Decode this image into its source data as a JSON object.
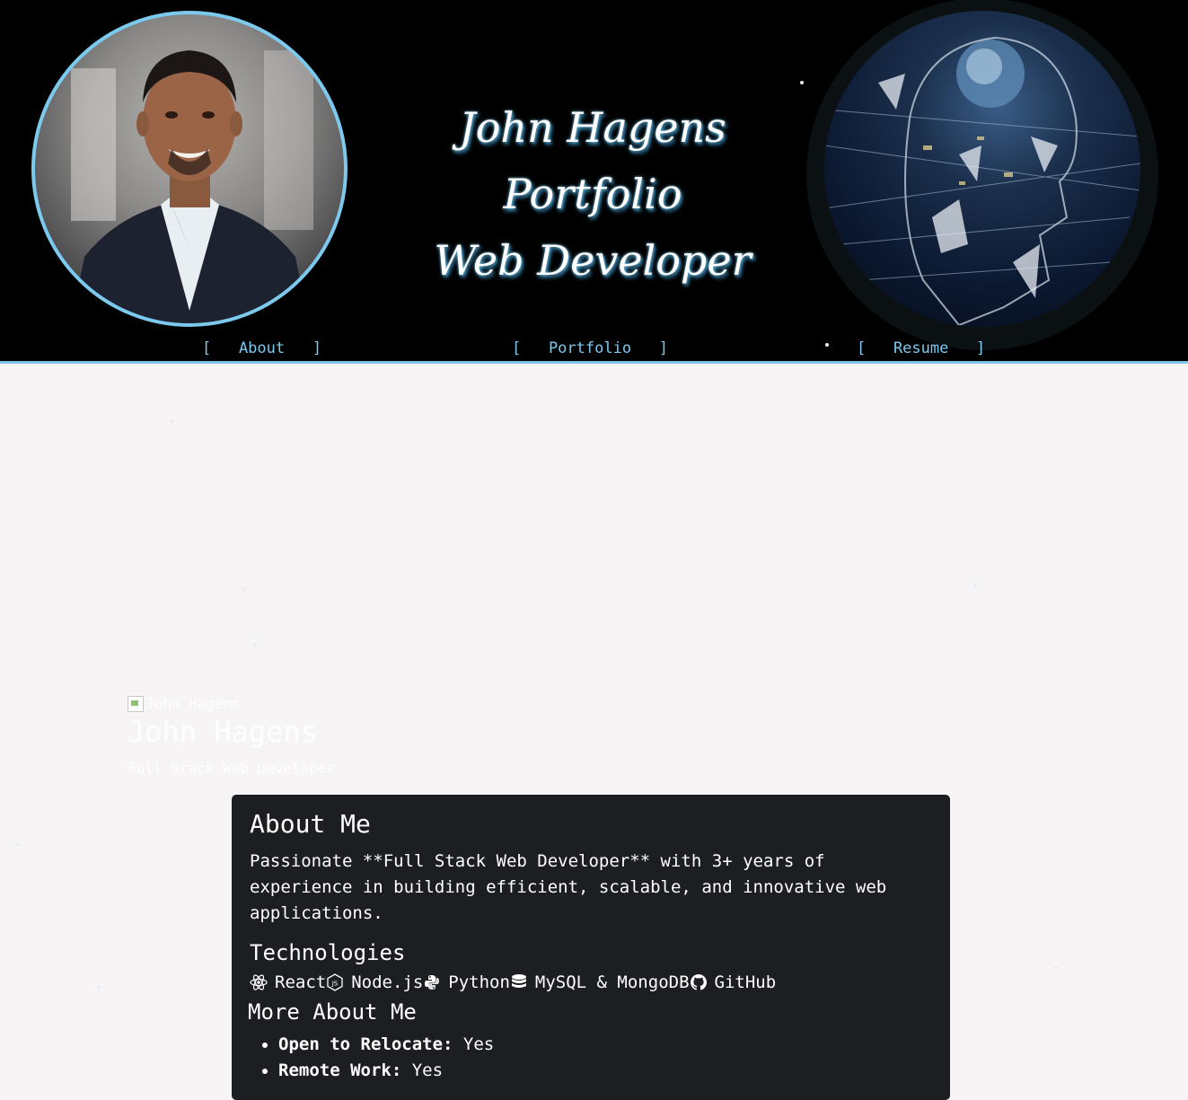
{
  "header": {
    "title_line1": "John Hagens Portfolio",
    "title_line2": "Web Developer",
    "nav": [
      {
        "label": "[   About   ]"
      },
      {
        "label": "[   Portfolio   ]"
      },
      {
        "label": "[   Resume   ]"
      }
    ]
  },
  "profile": {
    "image_alt": "John Hagens",
    "name": "John Hagens",
    "role": "Full Stack Web Developer"
  },
  "about": {
    "heading": "About Me",
    "bio": "Passionate **Full Stack Web Developer** with 3+ years of experience in building efficient, scalable, and innovative web applications.",
    "tech_heading": "Technologies",
    "technologies": [
      {
        "icon": "react-icon",
        "label": "React"
      },
      {
        "icon": "nodejs-icon",
        "label": "Node.js"
      },
      {
        "icon": "python-icon",
        "label": "Python"
      },
      {
        "icon": "database-icon",
        "label": "MySQL & MongoDB"
      },
      {
        "icon": "github-icon",
        "label": "GitHub"
      }
    ],
    "more_heading": "More About Me",
    "more_items": [
      {
        "key": "Open to Relocate:",
        "value": "Yes"
      },
      {
        "key": "Remote Work:",
        "value": "Yes"
      }
    ]
  },
  "colors": {
    "accent": "#7cc9ee",
    "header_bg": "#000000",
    "page_bg": "#f6f4f5",
    "card_bg": "#1d1e22"
  }
}
